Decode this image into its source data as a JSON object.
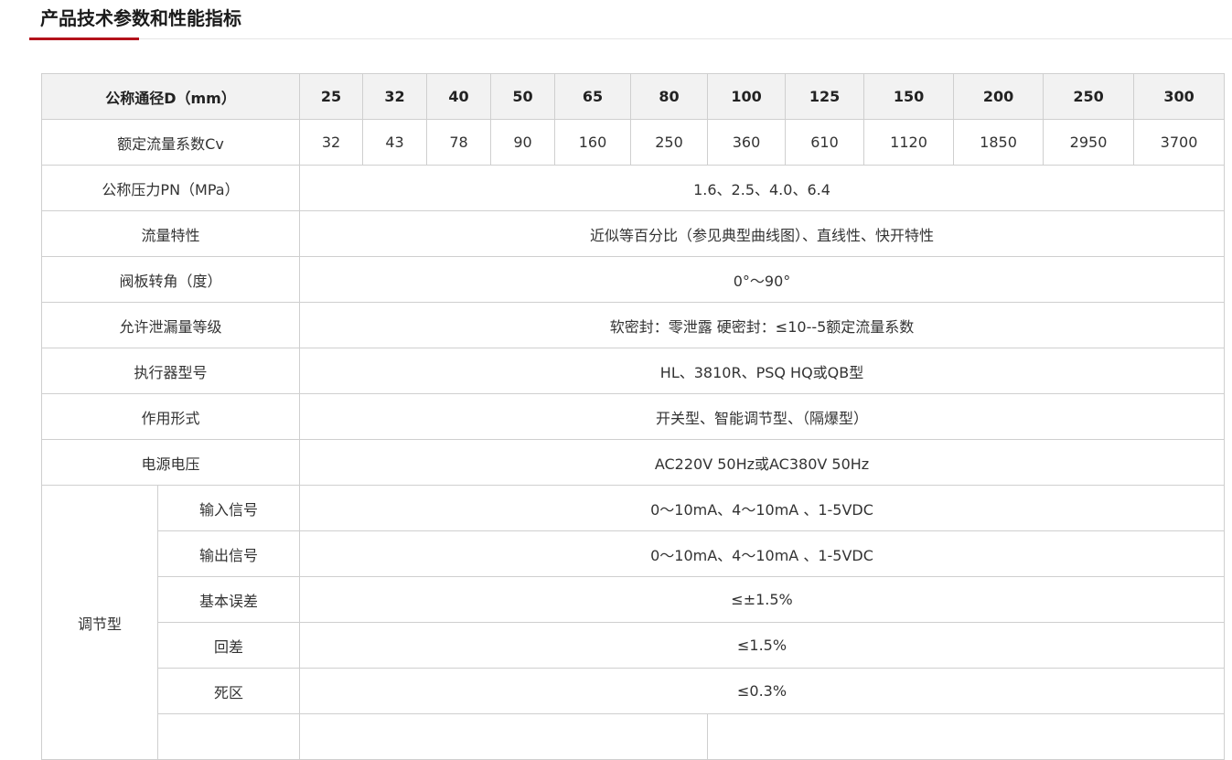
{
  "section": {
    "title": "产品技术参数和性能指标"
  },
  "table": {
    "header_label": "公称通径D（mm）",
    "diameters": [
      "25",
      "32",
      "40",
      "50",
      "65",
      "80",
      "100",
      "125",
      "150",
      "200",
      "250",
      "300"
    ],
    "cv_label": "额定流量系数Cv",
    "cv_values": [
      "32",
      "43",
      "78",
      "90",
      "160",
      "250",
      "360",
      "610",
      "1120",
      "1850",
      "2950",
      "3700"
    ],
    "rows": [
      {
        "label": "公称压力PN（MPa）",
        "value": "1.6、2.5、4.0、6.4"
      },
      {
        "label": "流量特性",
        "value": "近似等百分比（参见典型曲线图）、直线性、快开特性"
      },
      {
        "label": "阀板转角（度）",
        "value": "0°～90°"
      },
      {
        "label": "允许泄漏量等级",
        "value": "软密封：零泄露 硬密封：≤10--5额定流量系数"
      },
      {
        "label": "执行器型号",
        "value": "HL、3810R、PSQ HQ或QB型"
      },
      {
        "label": "作用形式",
        "value": "开关型、智能调节型、（隔爆型）"
      },
      {
        "label": "电源电压",
        "value": "AC220V 50Hz或AC380V 50Hz"
      }
    ],
    "group_label": "调节型",
    "group_rows": [
      {
        "label": "输入信号",
        "value": "0～10mA、4～10mA 、1-5VDC"
      },
      {
        "label": "输出信号",
        "value": "0～10mA、4～10mA 、1-5VDC"
      },
      {
        "label": "基本误差",
        "value": "≤±1.5%"
      },
      {
        "label": "回差",
        "value": "≤1.5%"
      },
      {
        "label": "死区",
        "value": "≤0.3%"
      }
    ]
  },
  "colors": {
    "accent": "#b3121b",
    "header_bg": "#f2f2f2",
    "border": "#cfcfcf"
  }
}
